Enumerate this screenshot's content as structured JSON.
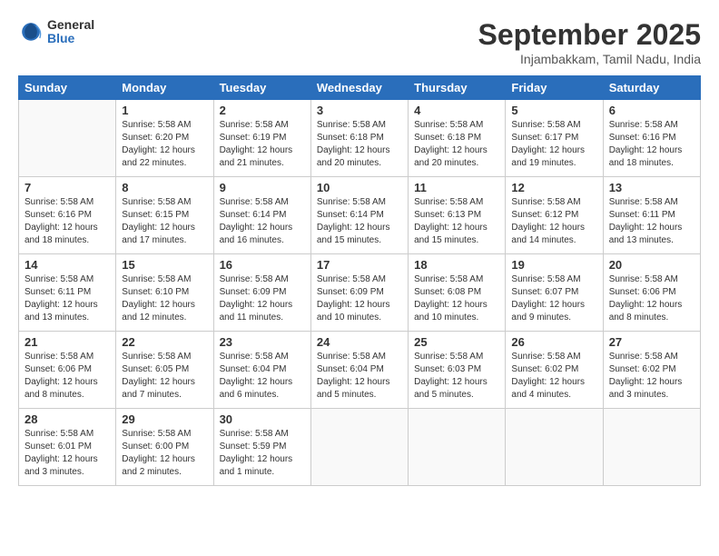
{
  "logo": {
    "general": "General",
    "blue": "Blue"
  },
  "title": "September 2025",
  "subtitle": "Injambakkam, Tamil Nadu, India",
  "days": [
    "Sunday",
    "Monday",
    "Tuesday",
    "Wednesday",
    "Thursday",
    "Friday",
    "Saturday"
  ],
  "weeks": [
    [
      {
        "day": "",
        "info": ""
      },
      {
        "day": "1",
        "info": "Sunrise: 5:58 AM\nSunset: 6:20 PM\nDaylight: 12 hours\nand 22 minutes."
      },
      {
        "day": "2",
        "info": "Sunrise: 5:58 AM\nSunset: 6:19 PM\nDaylight: 12 hours\nand 21 minutes."
      },
      {
        "day": "3",
        "info": "Sunrise: 5:58 AM\nSunset: 6:18 PM\nDaylight: 12 hours\nand 20 minutes."
      },
      {
        "day": "4",
        "info": "Sunrise: 5:58 AM\nSunset: 6:18 PM\nDaylight: 12 hours\nand 20 minutes."
      },
      {
        "day": "5",
        "info": "Sunrise: 5:58 AM\nSunset: 6:17 PM\nDaylight: 12 hours\nand 19 minutes."
      },
      {
        "day": "6",
        "info": "Sunrise: 5:58 AM\nSunset: 6:16 PM\nDaylight: 12 hours\nand 18 minutes."
      }
    ],
    [
      {
        "day": "7",
        "info": "Sunrise: 5:58 AM\nSunset: 6:16 PM\nDaylight: 12 hours\nand 18 minutes."
      },
      {
        "day": "8",
        "info": "Sunrise: 5:58 AM\nSunset: 6:15 PM\nDaylight: 12 hours\nand 17 minutes."
      },
      {
        "day": "9",
        "info": "Sunrise: 5:58 AM\nSunset: 6:14 PM\nDaylight: 12 hours\nand 16 minutes."
      },
      {
        "day": "10",
        "info": "Sunrise: 5:58 AM\nSunset: 6:14 PM\nDaylight: 12 hours\nand 15 minutes."
      },
      {
        "day": "11",
        "info": "Sunrise: 5:58 AM\nSunset: 6:13 PM\nDaylight: 12 hours\nand 15 minutes."
      },
      {
        "day": "12",
        "info": "Sunrise: 5:58 AM\nSunset: 6:12 PM\nDaylight: 12 hours\nand 14 minutes."
      },
      {
        "day": "13",
        "info": "Sunrise: 5:58 AM\nSunset: 6:11 PM\nDaylight: 12 hours\nand 13 minutes."
      }
    ],
    [
      {
        "day": "14",
        "info": "Sunrise: 5:58 AM\nSunset: 6:11 PM\nDaylight: 12 hours\nand 13 minutes."
      },
      {
        "day": "15",
        "info": "Sunrise: 5:58 AM\nSunset: 6:10 PM\nDaylight: 12 hours\nand 12 minutes."
      },
      {
        "day": "16",
        "info": "Sunrise: 5:58 AM\nSunset: 6:09 PM\nDaylight: 12 hours\nand 11 minutes."
      },
      {
        "day": "17",
        "info": "Sunrise: 5:58 AM\nSunset: 6:09 PM\nDaylight: 12 hours\nand 10 minutes."
      },
      {
        "day": "18",
        "info": "Sunrise: 5:58 AM\nSunset: 6:08 PM\nDaylight: 12 hours\nand 10 minutes."
      },
      {
        "day": "19",
        "info": "Sunrise: 5:58 AM\nSunset: 6:07 PM\nDaylight: 12 hours\nand 9 minutes."
      },
      {
        "day": "20",
        "info": "Sunrise: 5:58 AM\nSunset: 6:06 PM\nDaylight: 12 hours\nand 8 minutes."
      }
    ],
    [
      {
        "day": "21",
        "info": "Sunrise: 5:58 AM\nSunset: 6:06 PM\nDaylight: 12 hours\nand 8 minutes."
      },
      {
        "day": "22",
        "info": "Sunrise: 5:58 AM\nSunset: 6:05 PM\nDaylight: 12 hours\nand 7 minutes."
      },
      {
        "day": "23",
        "info": "Sunrise: 5:58 AM\nSunset: 6:04 PM\nDaylight: 12 hours\nand 6 minutes."
      },
      {
        "day": "24",
        "info": "Sunrise: 5:58 AM\nSunset: 6:04 PM\nDaylight: 12 hours\nand 5 minutes."
      },
      {
        "day": "25",
        "info": "Sunrise: 5:58 AM\nSunset: 6:03 PM\nDaylight: 12 hours\nand 5 minutes."
      },
      {
        "day": "26",
        "info": "Sunrise: 5:58 AM\nSunset: 6:02 PM\nDaylight: 12 hours\nand 4 minutes."
      },
      {
        "day": "27",
        "info": "Sunrise: 5:58 AM\nSunset: 6:02 PM\nDaylight: 12 hours\nand 3 minutes."
      }
    ],
    [
      {
        "day": "28",
        "info": "Sunrise: 5:58 AM\nSunset: 6:01 PM\nDaylight: 12 hours\nand 3 minutes."
      },
      {
        "day": "29",
        "info": "Sunrise: 5:58 AM\nSunset: 6:00 PM\nDaylight: 12 hours\nand 2 minutes."
      },
      {
        "day": "30",
        "info": "Sunrise: 5:58 AM\nSunset: 5:59 PM\nDaylight: 12 hours\nand 1 minute."
      },
      {
        "day": "",
        "info": ""
      },
      {
        "day": "",
        "info": ""
      },
      {
        "day": "",
        "info": ""
      },
      {
        "day": "",
        "info": ""
      }
    ]
  ]
}
